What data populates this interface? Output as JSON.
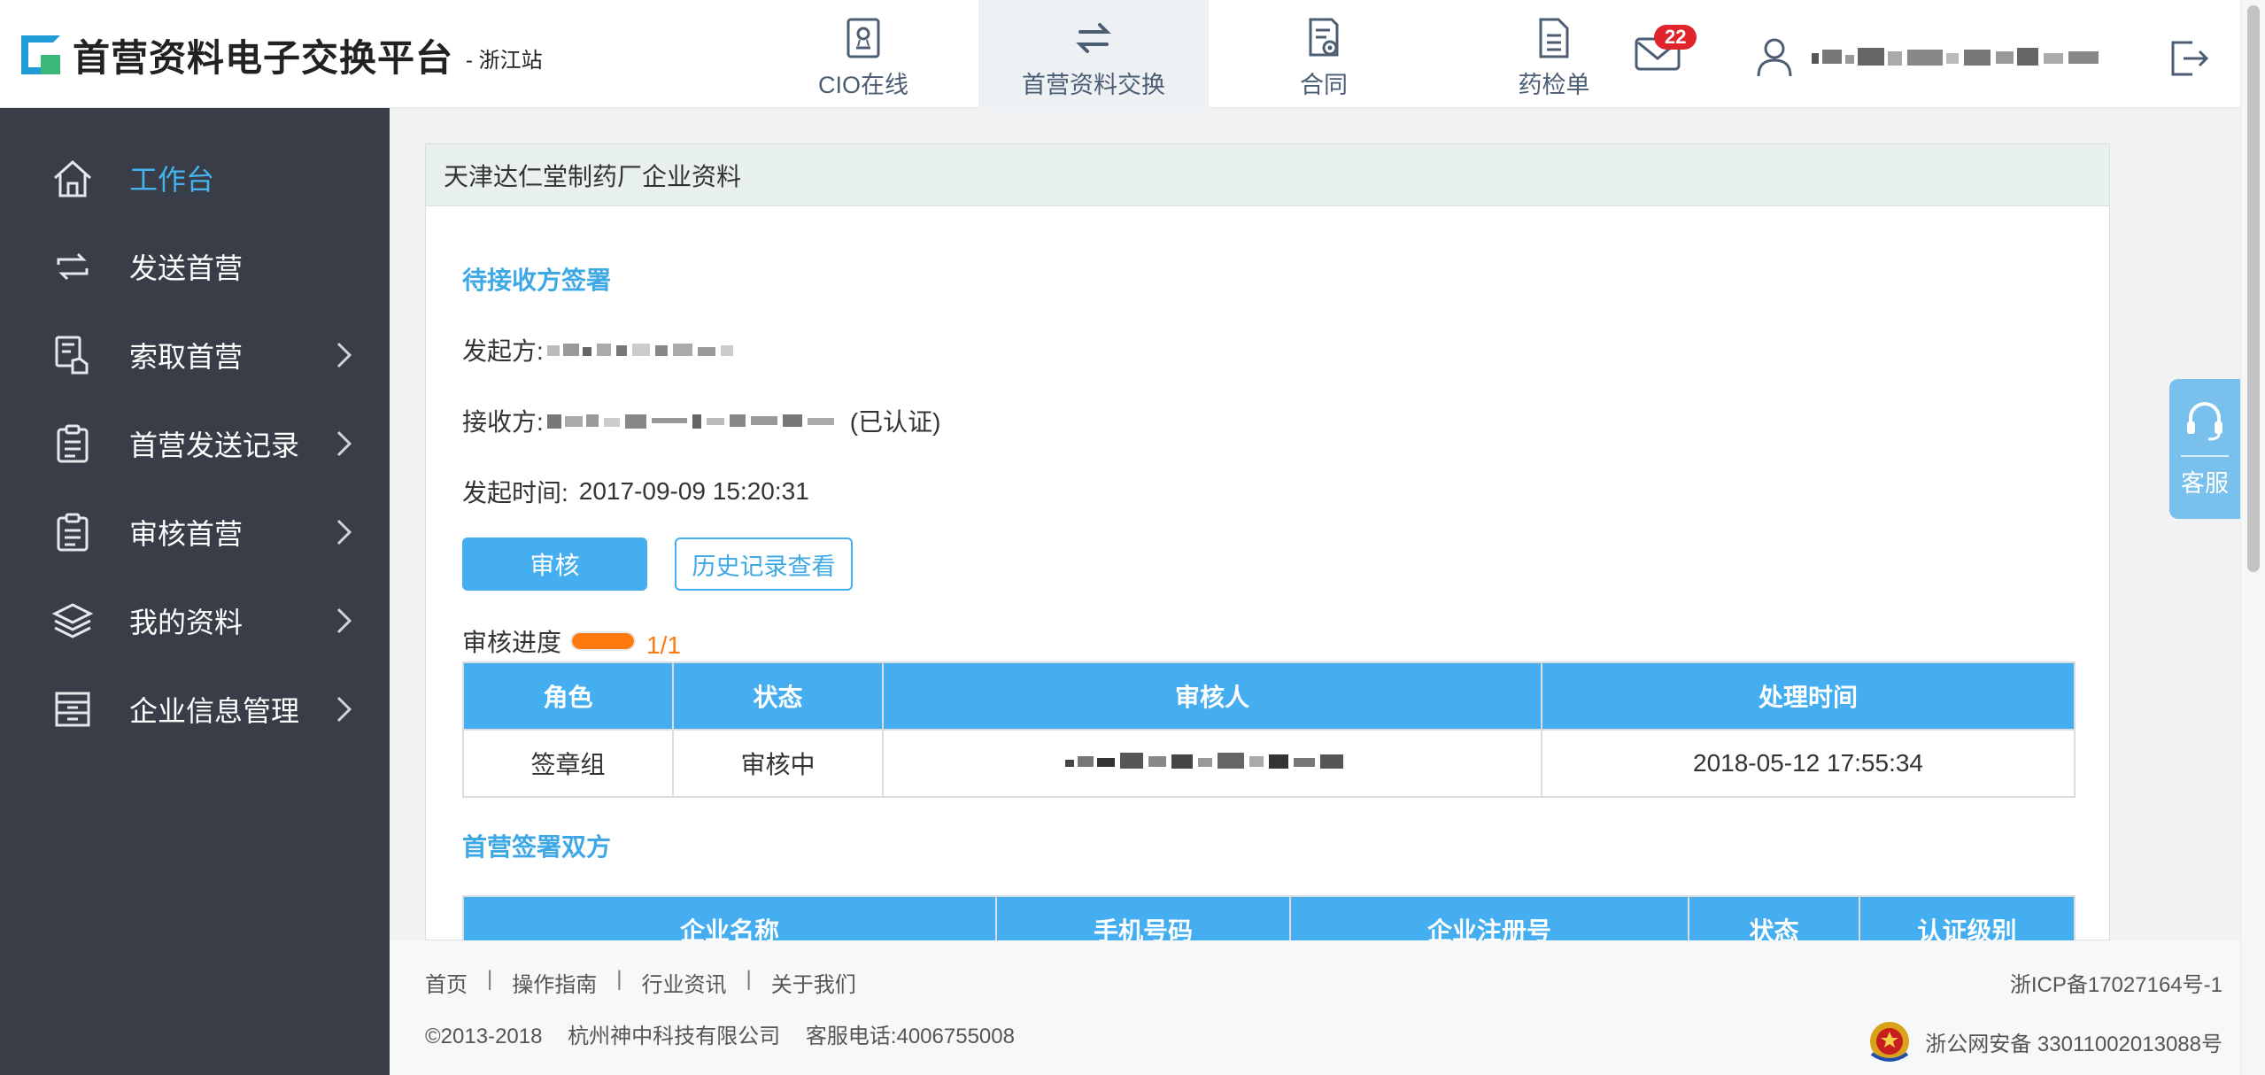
{
  "header": {
    "title": "首营资料电子交换平台",
    "site": "- 浙江站",
    "nav": [
      {
        "label": "CIO在线",
        "icon": "certificate-icon",
        "active": false
      },
      {
        "label": "首营资料交换",
        "icon": "exchange-arrows-icon",
        "active": true
      },
      {
        "label": "合同",
        "icon": "contract-icon",
        "active": false
      },
      {
        "label": "药检单",
        "icon": "document-icon",
        "active": false
      }
    ],
    "mail_count": "22"
  },
  "sidebar": {
    "items": [
      {
        "label": "工作台",
        "icon": "home-icon",
        "active": true,
        "has_arrow": false
      },
      {
        "label": "发送首营",
        "icon": "repeat-icon",
        "active": false,
        "has_arrow": false
      },
      {
        "label": "索取首营",
        "icon": "hand-document-icon",
        "active": false,
        "has_arrow": true
      },
      {
        "label": "首营发送记录",
        "icon": "clipboard-icon",
        "active": false,
        "has_arrow": true
      },
      {
        "label": "审核首营",
        "icon": "clipboard-check-icon",
        "active": false,
        "has_arrow": true
      },
      {
        "label": "我的资料",
        "icon": "layers-icon",
        "active": false,
        "has_arrow": true
      },
      {
        "label": "企业信息管理",
        "icon": "archive-icon",
        "active": false,
        "has_arrow": true
      }
    ]
  },
  "panel": {
    "title": "天津达仁堂制药厂企业资料",
    "pending_title": "待接收方签署",
    "initiator_label": "发起方:",
    "receiver_label": "接收方:",
    "receiver_suffix": "(已认证)",
    "time_label": "发起时间:",
    "time_value": "2017-09-09 15:20:31",
    "review_button": "审核",
    "history_button": "历史记录查看",
    "progress_label": "审核进度",
    "progress_value": 1.0,
    "progress_text": "1/1",
    "review_table": {
      "headers": [
        "角色",
        "状态",
        "审核人",
        "处理时间"
      ],
      "rows": [
        {
          "role": "签章组",
          "status": "审核中",
          "time": "2018-05-12 17:55:34"
        }
      ]
    },
    "parties_title": "首营签署双方",
    "parties_table": {
      "headers": [
        "企业名称",
        "手机号码",
        "企业注册号",
        "状态",
        "认证级别"
      ]
    }
  },
  "footer": {
    "links": [
      "首页",
      "操作指南",
      "行业资讯",
      "关于我们"
    ],
    "separator": "|",
    "copyright": "©2013-2018",
    "company": "杭州神中科技有限公司",
    "phone": "客服电话:4006755008",
    "icp": "浙ICP备17027164号-1",
    "police": "浙公网安备 33011002013088号"
  },
  "service_widget": {
    "label": "客服",
    "icon": "headset-icon"
  },
  "colors": {
    "accent": "#44aef0",
    "sidebar_bg": "#383d47",
    "progress": "#ff7a0d",
    "badge": "#e0242b"
  }
}
